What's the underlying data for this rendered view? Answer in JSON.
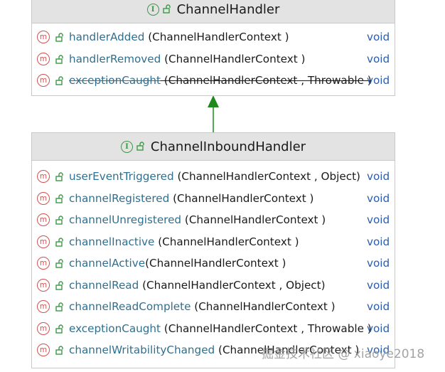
{
  "parent": {
    "title": "ChannelHandler",
    "methods": [
      {
        "name": "handlerAdded",
        "params": " (ChannelHandlerContext )",
        "ret": "void",
        "deprecated": false
      },
      {
        "name": "handlerRemoved",
        "params": " (ChannelHandlerContext )",
        "ret": "void",
        "deprecated": false
      },
      {
        "name": "exceptionCaught",
        "params": " (ChannelHandlerContext , Throwable )",
        "ret": "void",
        "deprecated": true
      }
    ]
  },
  "child": {
    "title": "ChannelInboundHandler",
    "methods": [
      {
        "name": "userEventTriggered",
        "params": " (ChannelHandlerContext , Object)",
        "ret": "void"
      },
      {
        "name": "channelRegistered",
        "params": " (ChannelHandlerContext )",
        "ret": "void"
      },
      {
        "name": "channelUnregistered",
        "params": " (ChannelHandlerContext )",
        "ret": "void"
      },
      {
        "name": "channelInactive",
        "params": " (ChannelHandlerContext )",
        "ret": "void"
      },
      {
        "name": "channelActive",
        "params": "(ChannelHandlerContext )",
        "ret": "void"
      },
      {
        "name": "channelRead",
        "params": " (ChannelHandlerContext , Object)",
        "ret": "void"
      },
      {
        "name": "channelReadComplete",
        "params": " (ChannelHandlerContext )",
        "ret": "void"
      },
      {
        "name": "exceptionCaught",
        "params": " (ChannelHandlerContext , Throwable )",
        "ret": "void"
      },
      {
        "name": "channelWritabilityChanged",
        "params": " (ChannelHandlerContext )",
        "ret": "void"
      }
    ]
  },
  "badges": {
    "interface": "I",
    "method": "m"
  },
  "watermark": "掘金技术社区 @ xiaoye2018",
  "colors": {
    "header_bg": "#e3e3e3",
    "border": "#c9c9c9",
    "method_name": "#2f6f8f",
    "return_type": "#2a5db0",
    "interface_badge": "#3a9a45",
    "method_badge": "#d3504e",
    "arrow": "#1e8a1e"
  }
}
